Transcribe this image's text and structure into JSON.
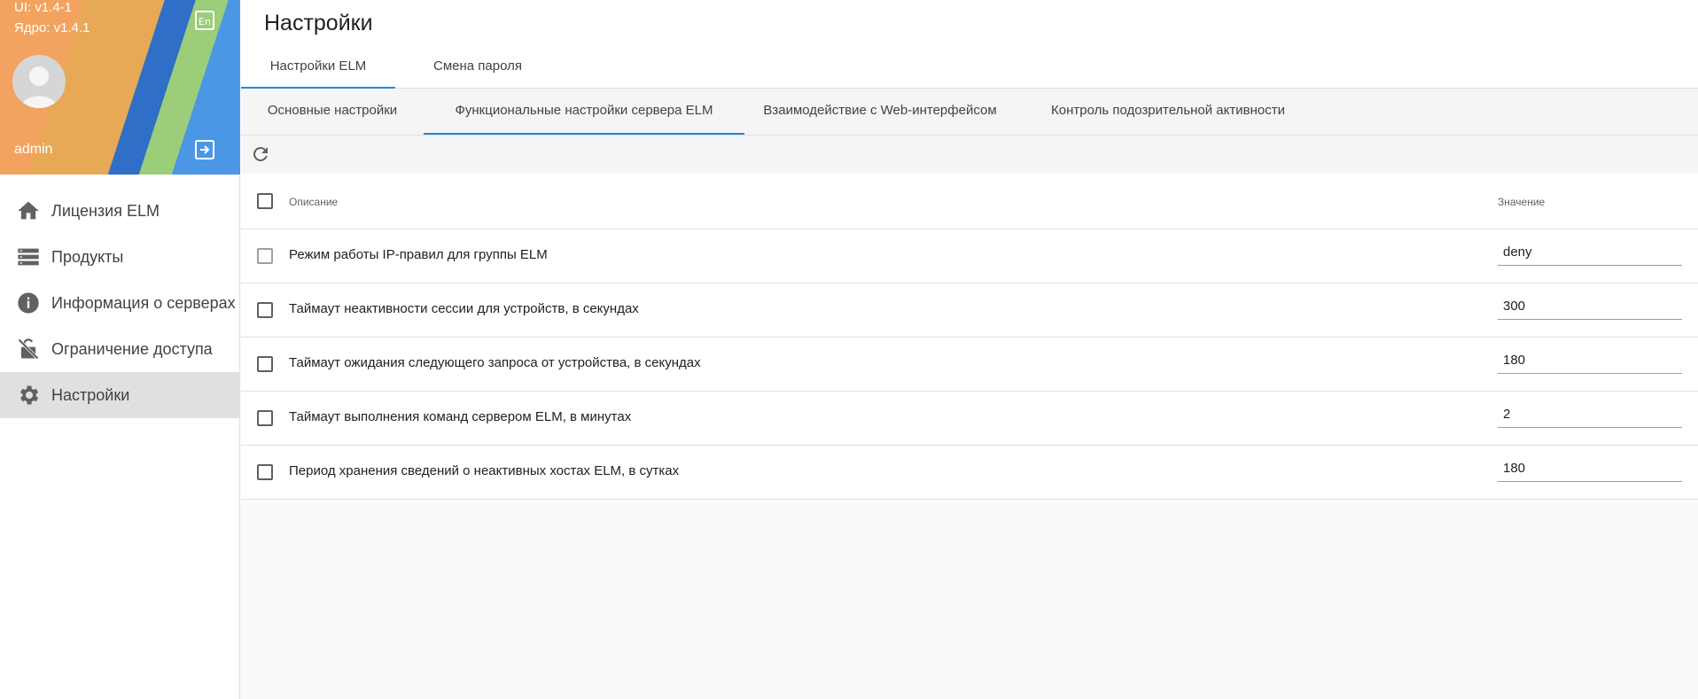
{
  "sidebar": {
    "ui_version": "UI: v1.4-1",
    "core_version": "Ядро: v1.4.1",
    "username": "admin",
    "items": [
      {
        "label": "Лицензия ELM",
        "icon": "home-icon",
        "active": false
      },
      {
        "label": "Продукты",
        "icon": "list-icon",
        "active": false
      },
      {
        "label": "Информация о серверах",
        "icon": "info-icon",
        "active": false
      },
      {
        "label": "Ограничение доступа",
        "icon": "lock-off-icon",
        "active": false
      },
      {
        "label": "Настройки",
        "icon": "gear-icon",
        "active": true
      }
    ]
  },
  "page": {
    "title": "Настройки",
    "tabs": [
      "Настройки ELM",
      "Смена пароля"
    ],
    "active_tab": 0,
    "subtabs": [
      "Основные настройки",
      "Функциональные настройки сервера ELM",
      "Взаимодействие с Web-интерфейсом",
      "Контроль подозрительной активности"
    ],
    "active_subtab": 1
  },
  "table": {
    "col_description": "Описание",
    "col_value": "Значение",
    "rows": [
      {
        "description": "Режим работы IP-правил для группы ELM",
        "value": "deny"
      },
      {
        "description": "Таймаут неактивности сессии для устройств, в секундах",
        "value": "300"
      },
      {
        "description": "Таймаут ожидания следующего запроса от устройства, в секундах",
        "value": "180"
      },
      {
        "description": "Таймаут выполнения команд сервером ELM, в минутах",
        "value": "2"
      },
      {
        "description": "Период хранения сведений о неактивных хостах ELM, в сутках",
        "value": "180"
      }
    ]
  },
  "colors": {
    "accent": "#1e88e5",
    "active_menu_bg": "#e0e0e0",
    "content_bg": "#fafafa"
  }
}
